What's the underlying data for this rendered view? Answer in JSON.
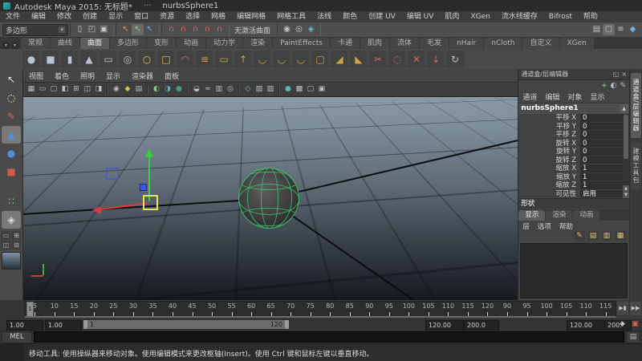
{
  "title_bar": {
    "app_title": "Autodesk Maya 2015: 无标题*",
    "dots": "···",
    "doc_name": "nurbsSphere1"
  },
  "menu_bar": [
    "文件",
    "编辑",
    "修改",
    "创建",
    "显示",
    "窗口",
    "资源",
    "选择",
    "网格",
    "编辑网格",
    "网格工具",
    "法线",
    "颜色",
    "创建 UV",
    "编辑 UV",
    "肌肉",
    "XGen",
    "流水线缓存",
    "Bifrost",
    "帮助"
  ],
  "status_line": {
    "menu_set": "多边形",
    "make_live_label": "无激活曲面",
    "groups": [
      {
        "name": "file",
        "icons": [
          {
            "n": "new-scene-icon",
            "g": "▯"
          },
          {
            "n": "open-scene-icon",
            "g": "◰"
          },
          {
            "n": "save-scene-icon",
            "g": "▣"
          }
        ]
      },
      {
        "name": "selection-mode",
        "icons": [
          {
            "n": "select-hierarchy-icon",
            "g": "↖",
            "c": "#d9a04a"
          },
          {
            "n": "select-object-icon",
            "g": "↖",
            "c": "#8fd08f",
            "active": true
          },
          {
            "n": "select-component-icon",
            "g": "↖",
            "c": "#6fb3e0"
          }
        ]
      },
      {
        "name": "snap",
        "icons": [
          {
            "n": "snap-grid-icon",
            "g": "∩",
            "c": "#d06a6a"
          },
          {
            "n": "snap-curve-icon",
            "g": "∩",
            "c": "#d06a6a"
          },
          {
            "n": "snap-point-icon",
            "g": "∩",
            "c": "#d06a6a"
          },
          {
            "n": "snap-projected-center-icon",
            "g": "∩",
            "c": "#d06a6a"
          },
          {
            "n": "snap-view-plane-icon",
            "g": "∩",
            "c": "#d06a6a"
          }
        ]
      }
    ],
    "render_icons": [
      {
        "n": "render-view-icon",
        "g": "◉"
      },
      {
        "n": "ipr-render-icon",
        "g": "◎"
      },
      {
        "n": "render-settings-icon",
        "g": "◈",
        "c": "#6fb3e0"
      }
    ],
    "panel_toggle_icons": [
      {
        "n": "sidebar-attribute-editor-icon",
        "g": "▤"
      },
      {
        "n": "sidebar-tool-settings-icon",
        "g": "▢",
        "active": true
      },
      {
        "n": "sidebar-channel-box-icon",
        "g": "≡"
      },
      {
        "n": "modeling-toolkit-icon",
        "g": "◆",
        "c": "#6fb3e0"
      }
    ]
  },
  "shelf": {
    "active_tab": "曲面",
    "tabs": [
      "常规",
      "曲线",
      "曲面",
      "多边形",
      "变形",
      "动画",
      "动力学",
      "渲染",
      "PaintEffects",
      "卡通",
      "肌肉",
      "流体",
      "毛发",
      "nHair",
      "nCloth",
      "自定义",
      "XGen"
    ],
    "icons": [
      {
        "n": "nurbs-sphere-icon",
        "g": "●",
        "c": "#b9c2cc"
      },
      {
        "n": "nurbs-cube-icon",
        "g": "■",
        "c": "#b9c2cc"
      },
      {
        "n": "nurbs-cylinder-icon",
        "g": "▮",
        "c": "#b9c2cc"
      },
      {
        "n": "nurbs-cone-icon",
        "g": "▲",
        "c": "#b9c2cc"
      },
      {
        "n": "nurbs-plane-icon",
        "g": "▭",
        "c": "#b9c2cc"
      },
      {
        "n": "nurbs-torus-icon",
        "g": "◎",
        "c": "#b9c2cc"
      },
      {
        "n": "nurbs-circle-icon",
        "g": "○",
        "c": "#d9c04a"
      },
      {
        "n": "nurbs-square-icon",
        "g": "□",
        "c": "#d9c04a"
      },
      {
        "n": "revolve-icon",
        "g": "◠",
        "c": "#d06a6a"
      },
      {
        "n": "loft-icon",
        "g": "≡",
        "c": "#caa54a"
      },
      {
        "n": "planar-icon",
        "g": "▭",
        "c": "#caa54a"
      },
      {
        "n": "extrude-icon",
        "g": "↑",
        "c": "#caa54a"
      },
      {
        "n": "birail-1-icon",
        "g": "◡",
        "c": "#caa54a"
      },
      {
        "n": "birail-2-icon",
        "g": "◡",
        "c": "#caa54a"
      },
      {
        "n": "birail-3-icon",
        "g": "◡",
        "c": "#caa54a"
      },
      {
        "n": "boundary-icon",
        "g": "▢",
        "c": "#caa54a"
      },
      {
        "n": "bevel-icon",
        "g": "◢",
        "c": "#caa54a"
      },
      {
        "n": "bevel-plus-icon",
        "g": "◣",
        "c": "#caa54a"
      },
      {
        "n": "trim-icon",
        "g": "✂",
        "c": "#d06a6a"
      },
      {
        "n": "untrim-icon",
        "g": "◌",
        "c": "#d06a6a"
      },
      {
        "n": "intersect-surfaces-icon",
        "g": "✕",
        "c": "#d06a6a"
      },
      {
        "n": "project-curve-icon",
        "g": "↓",
        "c": "#d06a6a"
      },
      {
        "n": "rebuild-surface-icon",
        "g": "↻",
        "c": "#b9c2cc"
      }
    ]
  },
  "toolbox": {
    "tools": [
      {
        "n": "select-tool",
        "g": "↖",
        "c": "#ececec"
      },
      {
        "n": "lasso-select-tool",
        "g": "◌",
        "c": "#ececec"
      },
      {
        "n": "paint-select-tool",
        "g": "✎",
        "c": "#d06a6a"
      },
      {
        "n": "move-tool",
        "g": "▲",
        "c": "#4f8fe0",
        "active": true
      },
      {
        "n": "rotate-tool",
        "g": "●",
        "c": "#4f8fe0"
      },
      {
        "n": "scale-tool",
        "g": "■",
        "c": "#cf5a4e"
      }
    ],
    "extra_tools": [
      {
        "n": "universal-manipulator-icon",
        "g": "∷",
        "c": "#9fd09f"
      },
      {
        "n": "last-tool-icon",
        "g": "◈",
        "c": "#dcdcdc",
        "active": true
      }
    ],
    "layout_buttons": [
      {
        "n": "single-pane-layout-button",
        "g": "▭"
      },
      {
        "n": "four-pane-layout-button",
        "g": "⊞"
      },
      {
        "n": "persp-outliner-layout-button",
        "g": "◫"
      },
      {
        "n": "split-pane-layout-button",
        "g": "⊟"
      }
    ]
  },
  "viewport": {
    "menus": [
      "视图",
      "着色",
      "照明",
      "显示",
      "渲染器",
      "面板"
    ],
    "toolbar_icons": [
      {
        "n": "grid-toggle-icon",
        "g": "▦"
      },
      {
        "n": "film-gate-icon",
        "g": "▭"
      },
      {
        "n": "resolution-gate-icon",
        "g": "▢"
      },
      {
        "n": "gate-mask-icon",
        "g": "◧"
      },
      {
        "n": "field-chart-icon",
        "g": "⊞"
      },
      {
        "n": "safe-action-icon",
        "g": "◫"
      },
      {
        "n": "safe-title-icon",
        "g": "◨"
      },
      {
        "sep": true
      },
      {
        "n": "camera-attributes-icon",
        "g": "◉"
      },
      {
        "n": "bookmark-icon",
        "g": "◆",
        "c": "#d9c04a"
      },
      {
        "n": "image-plane-icon",
        "g": "▤"
      },
      {
        "sep": true
      },
      {
        "n": "two-sided-lighting-icon",
        "g": "◐",
        "c": "#8fd08f"
      },
      {
        "n": "lights-icon",
        "g": "◑",
        "c": "#5fb3b3"
      },
      {
        "n": "shadows-icon",
        "g": "●",
        "c": "#3f9f7f"
      },
      {
        "sep": true
      },
      {
        "n": "screen-ao-icon",
        "g": "◒"
      },
      {
        "n": "motion-blur-icon",
        "g": "≈"
      },
      {
        "n": "multisample-icon",
        "g": "▥"
      },
      {
        "n": "depth-of-field-icon",
        "g": "◎"
      },
      {
        "sep": true
      },
      {
        "n": "isolate-select-icon",
        "g": "◇",
        "c": "#8fd08f"
      },
      {
        "n": "xray-icon",
        "g": "▧"
      },
      {
        "n": "wireframe-on-shaded-icon",
        "g": "▨"
      },
      {
        "sep": true
      },
      {
        "n": "default-material-icon",
        "g": "●",
        "c": "#5fb3b3"
      },
      {
        "n": "textured-mode-icon",
        "g": "▩"
      },
      {
        "n": "wireframe-mode-icon",
        "g": "▢"
      },
      {
        "n": "shaded-mode-icon",
        "g": "▣"
      }
    ]
  },
  "channel_box": {
    "panel_title": "通道盒/层编辑器",
    "window_buttons": [
      {
        "n": "float-panel-icon",
        "g": "◱"
      },
      {
        "n": "close-panel-icon",
        "g": "×"
      }
    ],
    "header_icons": [
      {
        "n": "manipulator-link-icon",
        "g": "+",
        "c": "#8fd08f"
      },
      {
        "n": "channel-speed-icon",
        "g": "◐",
        "c": "#c0c0c0"
      },
      {
        "n": "hyperbolic-edit-icon",
        "g": "✎",
        "c": "#c0c0c0"
      }
    ],
    "menus": [
      "通道",
      "编辑",
      "对象",
      "显示"
    ],
    "object_name": "nurbsSphere1",
    "attributes": [
      {
        "label": "平移 X",
        "value": "0"
      },
      {
        "label": "平移 Y",
        "value": "0"
      },
      {
        "label": "平移 Z",
        "value": "0"
      },
      {
        "label": "旋转 X",
        "value": "0"
      },
      {
        "label": "旋转 Y",
        "value": "0"
      },
      {
        "label": "旋转 Z",
        "value": "0"
      },
      {
        "label": "缩放 X",
        "value": "1"
      },
      {
        "label": "缩放 Y",
        "value": "1"
      },
      {
        "label": "缩放 Z",
        "value": "1"
      },
      {
        "label": "可见性",
        "value": "启用"
      }
    ],
    "section_label": "形状"
  },
  "layer_editor": {
    "tabs": [
      {
        "label": "显示",
        "active": true
      },
      {
        "label": "渲染",
        "active": false
      },
      {
        "label": "动画",
        "active": false
      }
    ],
    "menus": [
      "层",
      "选项",
      "帮助"
    ],
    "icons": [
      {
        "n": "edit-layer-icon",
        "g": "✎"
      },
      {
        "n": "empty-layer-icon",
        "g": "▤"
      },
      {
        "n": "new-layer-icon",
        "g": "▥"
      },
      {
        "n": "new-layer-from-selected-icon",
        "g": "▦"
      }
    ]
  },
  "side_tabs": [
    {
      "label": "通道盒/层编辑器",
      "active": true
    },
    {
      "label": "建模工具包",
      "active": false
    }
  ],
  "time_slider": {
    "current_frame": "1",
    "labels": [
      "5",
      "10",
      "15",
      "20",
      "25",
      "30",
      "35",
      "40",
      "45",
      "50",
      "55",
      "60",
      "65",
      "70",
      "75",
      "80",
      "85",
      "90",
      "95",
      "100",
      "105",
      "110",
      "115",
      "120",
      "90",
      "95",
      "100",
      "105",
      "110",
      "115"
    ],
    "playback_buttons": [
      {
        "n": "step-forward-button",
        "g": "▶▮"
      },
      {
        "n": "go-to-end-button",
        "g": "▶▶"
      }
    ]
  },
  "range_slider": {
    "animation_start": "1.00",
    "playback_start": "1.00",
    "range_start_label": "1",
    "range_end_label": "120",
    "playback_end": "120.00",
    "animation_end": "200.0",
    "playback_end_2": "120.00",
    "animation_end_2": "200.",
    "icons": [
      {
        "n": "auto-keyframe-icon",
        "g": "◆",
        "c": "#bdbdbd"
      },
      {
        "n": "animation-preferences-icon",
        "g": "▣",
        "c": "#c96a5a"
      }
    ]
  },
  "command_line": {
    "label": "MEL"
  },
  "help_line": {
    "text": "移动工具: 使用操纵器来移动对象。使用编辑模式来更改枢轴(Insert)。使用 Ctrl 键和鼠标左键以垂直移动。"
  }
}
